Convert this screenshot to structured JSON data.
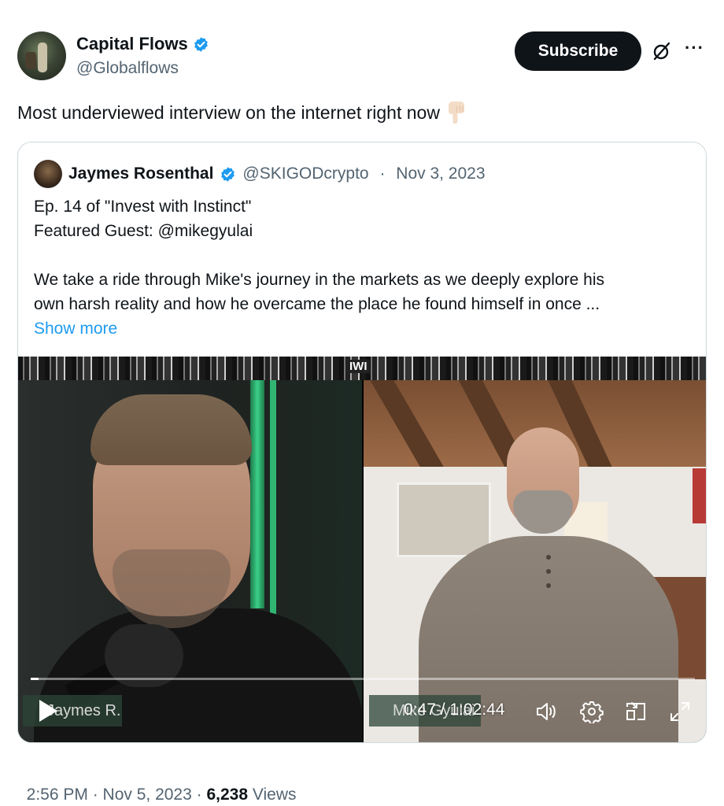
{
  "tweet": {
    "author_name": "Capital Flows",
    "author_handle": "@Globalflows",
    "subscribe_label": "Subscribe",
    "text": "Most underviewed interview on the internet right now",
    "emoji_icon": "backhand-index-pointing-down-icon",
    "timestamp": "2:56 PM · Nov 5, 2023 · ",
    "views_count": "6,238",
    "views_label": " Views"
  },
  "quote": {
    "author_name": "Jaymes Rosenthal",
    "author_handle": "@SKIGODcrypto",
    "separator": " · ",
    "date": "Nov 3, 2023",
    "lines": [
      "Ep. 14 of \"Invest with Instinct\"",
      "Featured Guest: @mikegyulai",
      "We take a ride through Mike's journey in the markets as we deeply explore his",
      "own harsh reality and how he overcame the place he found himself in once ..."
    ],
    "show_more": "Show more"
  },
  "video": {
    "logo_text": "IWI",
    "left_name_tag": "Jaymes R.",
    "right_name_tag": "Mike Gyulai",
    "time": "0:47 / 1:02:44",
    "progress": 0.012
  },
  "colors": {
    "verified": "#1d9bf0",
    "link": "#1d9bf0",
    "subscribe_bg": "#0f1419",
    "muted": "#536471"
  }
}
